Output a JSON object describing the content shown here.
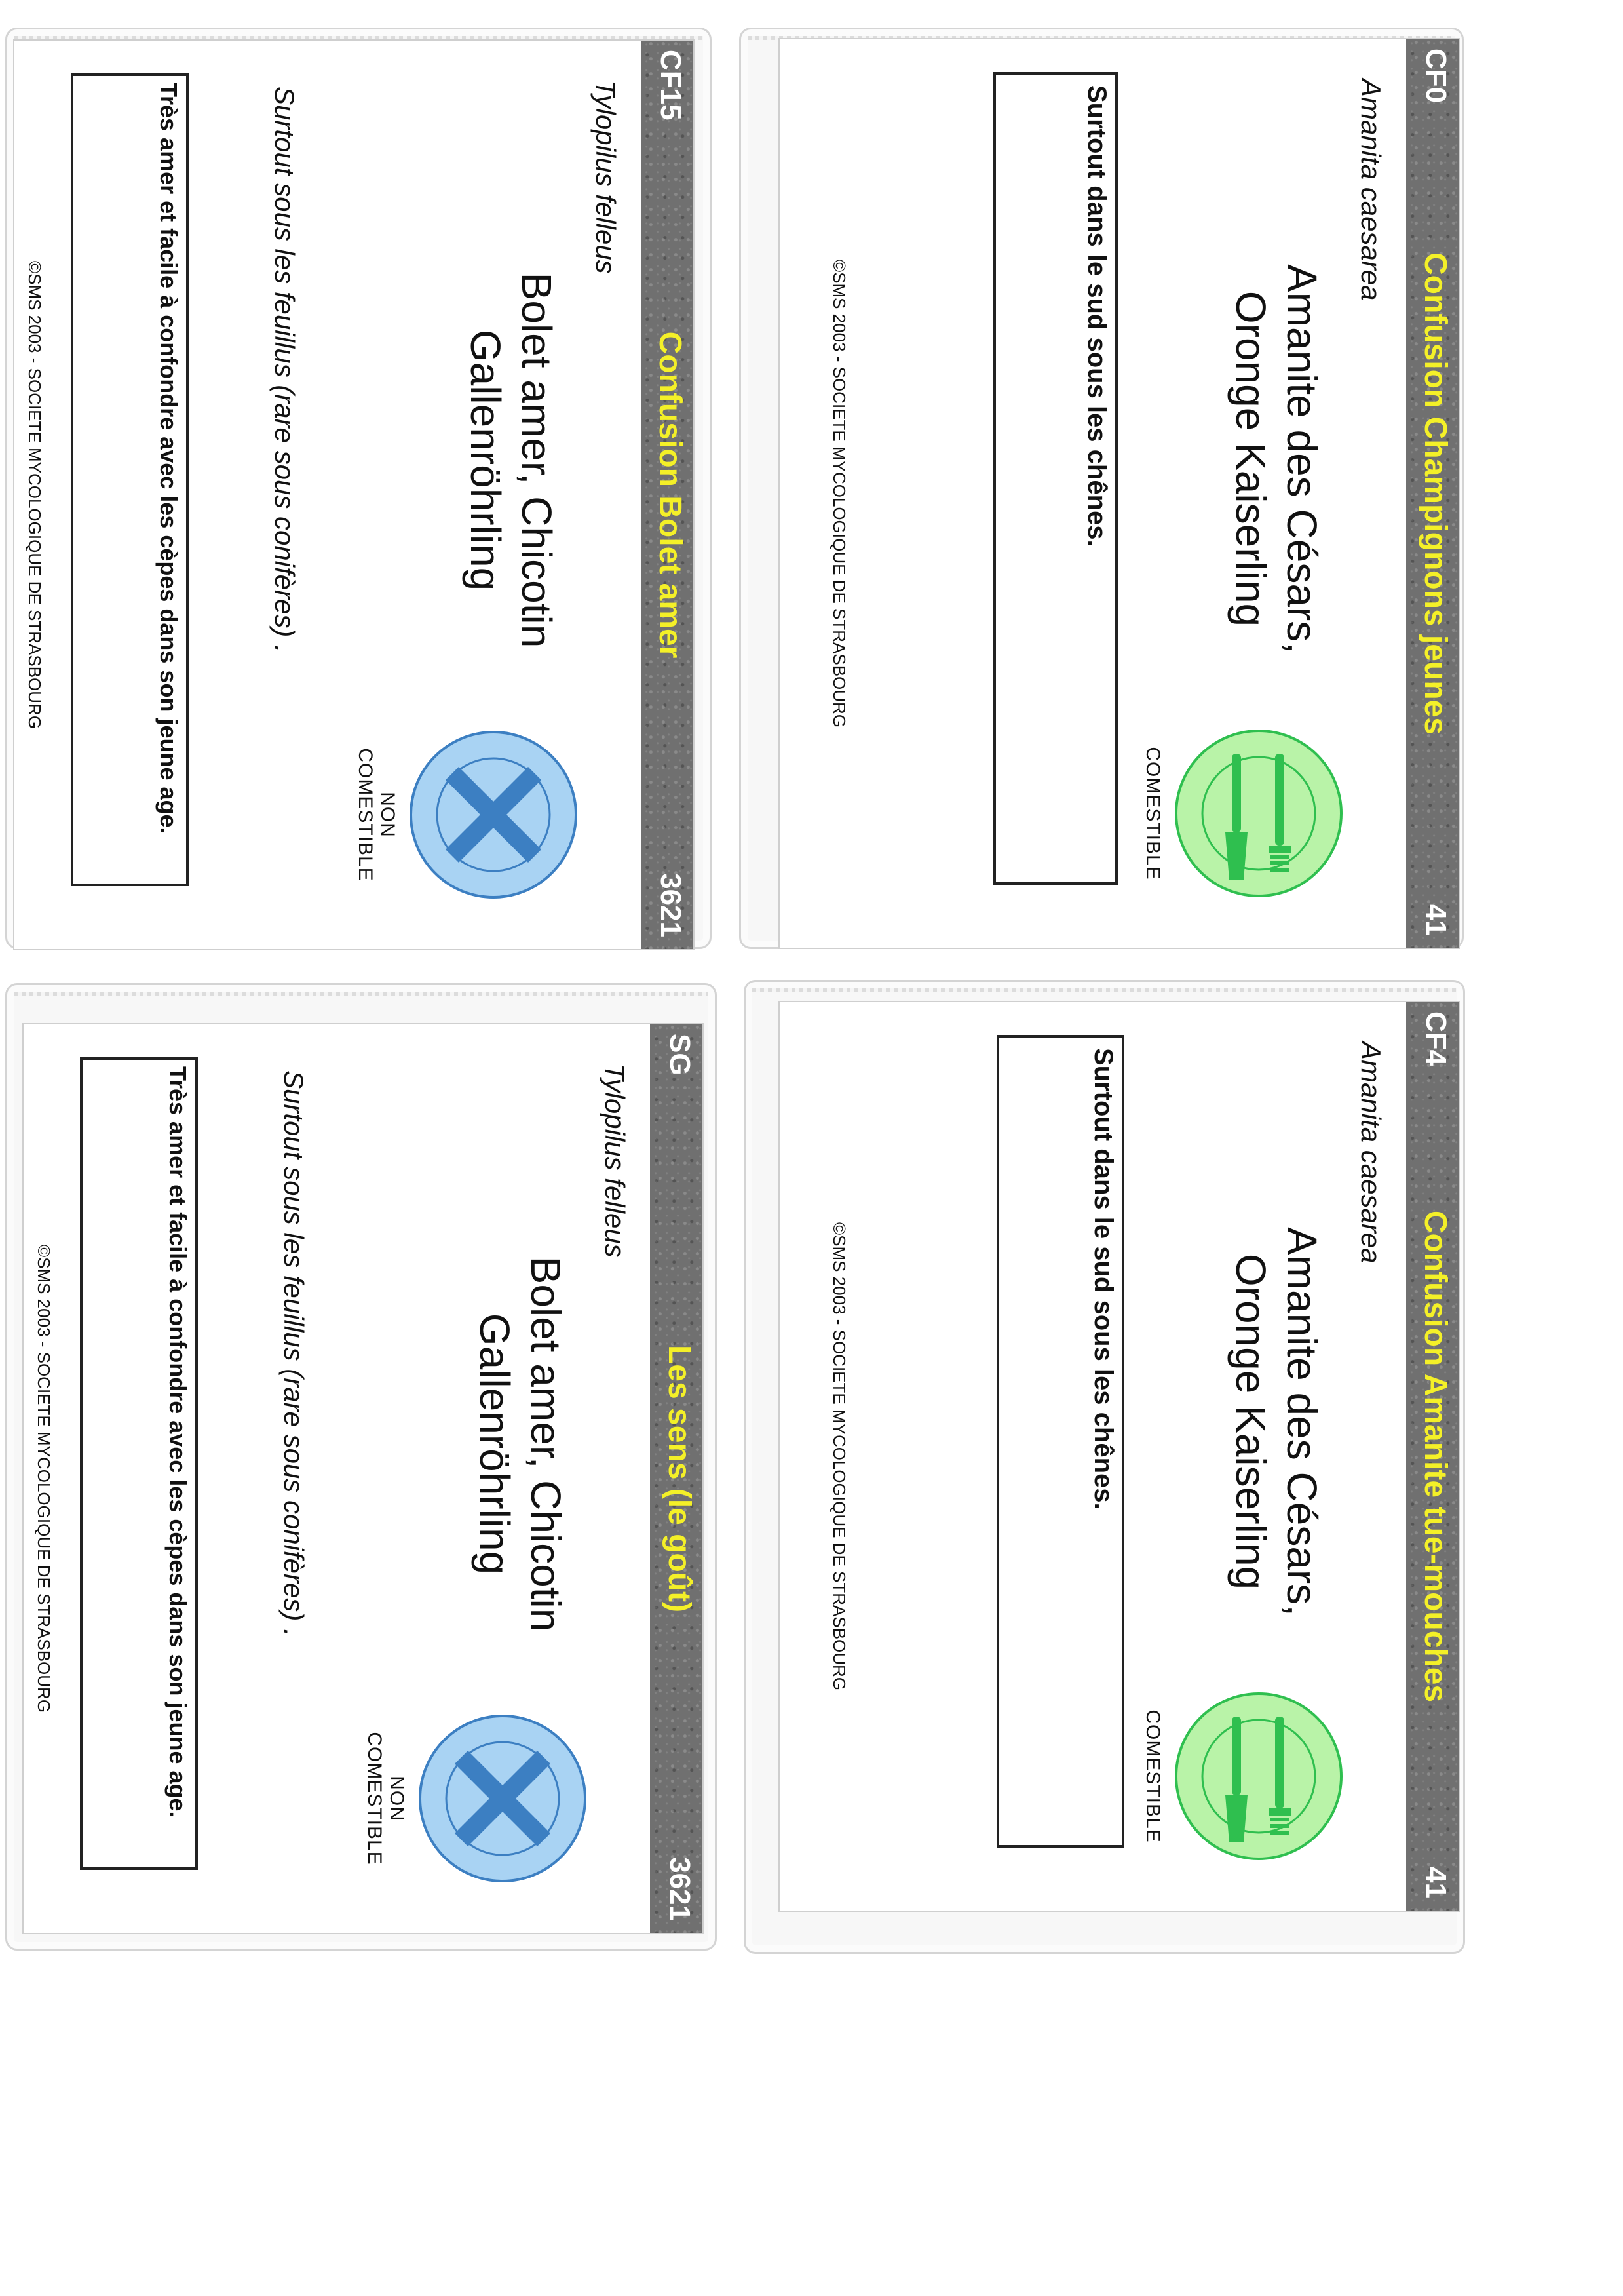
{
  "cards": {
    "c1": {
      "code": "CF0",
      "title": "Confusion Champignons jeunes",
      "number": "41",
      "latin_name": "Amanita caesarea",
      "common_name": "Amanite des Césars, Oronge Kaiserling",
      "verdict": "COMESTIBLE",
      "habitat": "Surtout dans le sud sous les chênes.",
      "notes": "",
      "copyright": "©SMS 2003 - SOCIETE MYCOLOGIQUE DE STRASBOURG"
    },
    "c2": {
      "code": "CF15",
      "title": "Confusion Bolet amer",
      "number": "3621",
      "latin_name": "Tylopilus felleus",
      "common_name": "Bolet amer, Chicotin Gallenröhrling",
      "verdict": "NON COMESTIBLE",
      "habitat": "Surtout sous les feuillus (rare sous conifères) .",
      "notes": "Très amer et facile à confondre avec les cèpes dans son jeune age.",
      "copyright": "©SMS 2003 - SOCIETE MYCOLOGIQUE DE STRASBOURG"
    },
    "c3": {
      "code": "CF4",
      "title": "Confusion Amanite tue-mouches",
      "number": "41",
      "latin_name": "Amanita caesarea",
      "common_name": "Amanite des Césars, Oronge Kaiserling",
      "verdict": "COMESTIBLE",
      "habitat": "Surtout dans le sud sous les chênes.",
      "notes": "",
      "copyright": "©SMS 2003 - SOCIETE MYCOLOGIQUE DE STRASBOURG"
    },
    "c4": {
      "code": "SG",
      "title": "Les sens (le goût)",
      "number": "3621",
      "latin_name": "Tylopilus felleus",
      "common_name": "Bolet amer, Chicotin Gallenröhrling",
      "verdict": "NON COMESTIBLE",
      "habitat": "Surtout sous les feuillus (rare sous conifères) .",
      "notes": "Très amer et facile à confondre avec les cèpes dans son jeune age.",
      "copyright": "©SMS 2003 - SOCIETE MYCOLOGIQUE DE STRASBOURG"
    }
  },
  "colors": {
    "band": "#707070",
    "title_yellow": "#f4f028",
    "edible_green_fill": "#b9f3a8",
    "edible_green_icon": "#2fbf4f",
    "inedible_blue_fill": "#a9d3f3",
    "inedible_blue_icon": "#3c7fc2"
  },
  "icons": {
    "edible": "plate-fork-knife-icon",
    "inedible": "plate-cross-icon"
  }
}
